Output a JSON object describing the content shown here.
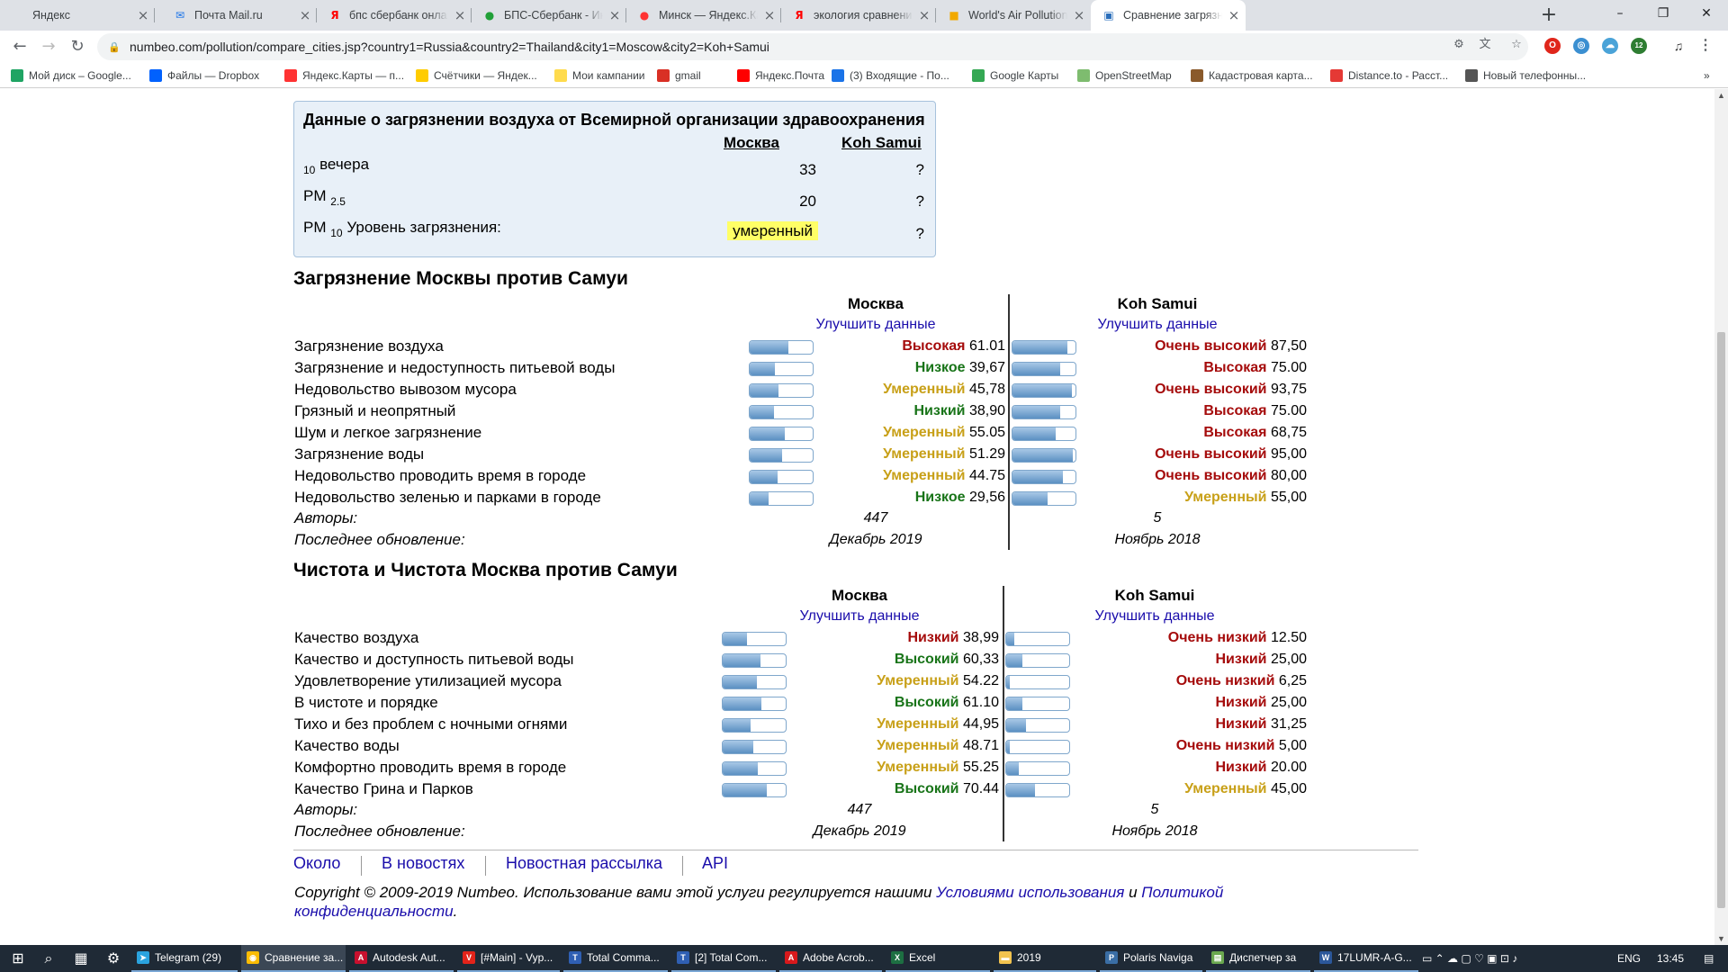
{
  "browser": {
    "tabs": [
      {
        "title": "Яндекс",
        "icon": "yandex-icon",
        "color": "#dee1e6"
      },
      {
        "title": "Почта Mail.ru",
        "icon": "mail-icon",
        "color": "#1a73e8"
      },
      {
        "title": "бпс сбербанк онлайн — Яндекс",
        "icon": "yandex-icon",
        "color": "#ff0000"
      },
      {
        "title": "БПС-Сбербанк - Интернет",
        "icon": "sber-icon",
        "color": "#21a038"
      },
      {
        "title": "Минск — Яндекс.Карты",
        "icon": "map-pin-icon",
        "color": "#ff3333"
      },
      {
        "title": "экология сравнение город",
        "icon": "yandex-icon",
        "color": "#ff0000"
      },
      {
        "title": "World's Air Pollution: Real-t",
        "icon": "aqicn-icon",
        "color": "#f2a900"
      },
      {
        "title": "Сравнение загрязнения м",
        "icon": "numbeo-icon",
        "color": "#2a6ebb"
      }
    ],
    "url": "numbeo.com/pollution/compare_cities.jsp?country1=Russia&country2=Thailand&city1=Moscow&city2=Koh+Samui",
    "bookmarks": [
      {
        "label": "Мой диск – Google...",
        "icon": "google-drive-icon",
        "color": "#1fa463"
      },
      {
        "label": "Файлы — Dropbox",
        "icon": "dropbox-icon",
        "color": "#0061fe"
      },
      {
        "label": "Яндекс.Карты — п...",
        "icon": "map-pin-icon",
        "color": "#ff3333"
      },
      {
        "label": "Счётчики — Яндек...",
        "icon": "metrika-icon",
        "color": "#ffcc00"
      },
      {
        "label": "Мои кампании",
        "icon": "direct-icon",
        "color": "#ffdb4d"
      },
      {
        "label": "gmail",
        "icon": "gmail-icon",
        "color": "#d93025"
      },
      {
        "label": "Яндекс.Почта",
        "icon": "yandex-mail-icon",
        "color": "#ff0000"
      },
      {
        "label": "(3) Входящие - По...",
        "icon": "mail-icon",
        "color": "#1a73e8"
      },
      {
        "label": "Google Карты",
        "icon": "google-maps-icon",
        "color": "#34a853"
      },
      {
        "label": "OpenStreetMap",
        "icon": "osm-icon",
        "color": "#7ebc6f"
      },
      {
        "label": "Кадастровая карта...",
        "icon": "cadastre-icon",
        "color": "#8a5a2b"
      },
      {
        "label": "Distance.to - Расст...",
        "icon": "distance-icon",
        "color": "#e53935"
      },
      {
        "label": "Новый телефонны...",
        "icon": "globe-icon",
        "color": "#555555"
      }
    ],
    "ext_badge": "12"
  },
  "who": {
    "heading": "Данные о загрязнении воздуха от Всемирной организации здравоохранения",
    "city1": "Москва",
    "city2": "Koh Samui",
    "r1_sub": "10",
    "r1_label": "вечера",
    "r1_v1": "33",
    "r1_v2": "?",
    "r2_label": "PM",
    "r2_sub": "2.5",
    "r2_v1": "20",
    "r2_v2": "?",
    "r3_label": "PM",
    "r3_sub": "10",
    "r3_rest": "Уровень загрязнения:",
    "r3_v1": "умеренный",
    "r3_v2": "?"
  },
  "pollution": {
    "title": "Загрязнение Москвы против Самуи",
    "city1": "Москва",
    "city2": "Koh Samui",
    "improve": "Улучшить данные",
    "rows": [
      {
        "label": "Загрязнение воздуха",
        "w1": "Высокая",
        "v1": "61.01",
        "c1": "red",
        "w2": "Очень высокий",
        "v2": "87,50",
        "c2": "red",
        "p1": 61.01,
        "p2": 87.5
      },
      {
        "label": "Загрязнение и недоступность питьевой воды",
        "w1": "Низкое",
        "v1": "39,67",
        "c1": "grn",
        "w2": "Высокая",
        "v2": "75.00",
        "c2": "red",
        "p1": 39.67,
        "p2": 75
      },
      {
        "label": "Недовольство вывозом мусора",
        "w1": "Умеренный",
        "v1": "45,78",
        "c1": "yel",
        "w2": "Очень высокий",
        "v2": "93,75",
        "c2": "red",
        "p1": 45.78,
        "p2": 93.75
      },
      {
        "label": "Грязный и неопрятный",
        "w1": "Низкий",
        "v1": "38,90",
        "c1": "grn",
        "w2": "Высокая",
        "v2": "75.00",
        "c2": "red",
        "p1": 38.9,
        "p2": 75
      },
      {
        "label": "Шум и легкое загрязнение",
        "w1": "Умеренный",
        "v1": "55.05",
        "c1": "yel",
        "w2": "Высокая",
        "v2": "68,75",
        "c2": "red",
        "p1": 55.05,
        "p2": 68.75
      },
      {
        "label": "Загрязнение воды",
        "w1": "Умеренный",
        "v1": "51.29",
        "c1": "yel",
        "w2": "Очень высокий",
        "v2": "95,00",
        "c2": "red",
        "p1": 51.29,
        "p2": 95
      },
      {
        "label": "Недовольство проводить время в городе",
        "w1": "Умеренный",
        "v1": "44.75",
        "c1": "yel",
        "w2": "Очень высокий",
        "v2": "80,00",
        "c2": "red",
        "p1": 44.75,
        "p2": 80
      },
      {
        "label": "Недовольство зеленью и парками в городе",
        "w1": "Низкое",
        "v1": "29,56",
        "c1": "grn",
        "w2": "Умеренный",
        "v2": "55,00",
        "c2": "yel",
        "p1": 29.56,
        "p2": 55
      }
    ],
    "authors_label": "Авторы:",
    "authors1": "447",
    "authors2": "5",
    "updated_label": "Последнее обновление:",
    "updated1": "Декабрь 2019",
    "updated2": "Ноябрь 2018"
  },
  "purity": {
    "title": "Чистота и Чистота Москва против Самуи",
    "city1": "Москва",
    "city2": "Koh Samui",
    "improve": "Улучшить данные",
    "rows": [
      {
        "label": "Качество воздуха",
        "w1": "Низкий",
        "v1": "38,99",
        "c1": "red",
        "w2": "Очень низкий",
        "v2": "12.50",
        "c2": "red",
        "p1": 38.99,
        "p2": 12.5
      },
      {
        "label": "Качество и доступность питьевой воды",
        "w1": "Высокий",
        "v1": "60,33",
        "c1": "grn",
        "w2": "Низкий",
        "v2": "25,00",
        "c2": "red",
        "p1": 60.33,
        "p2": 25
      },
      {
        "label": "Удовлетворение утилизацией мусора",
        "w1": "Умеренный",
        "v1": "54.22",
        "c1": "yel",
        "w2": "Очень низкий",
        "v2": "6,25",
        "c2": "red",
        "p1": 54.22,
        "p2": 6.25
      },
      {
        "label": "В чистоте и порядке",
        "w1": "Высокий",
        "v1": "61.10",
        "c1": "grn",
        "w2": "Низкий",
        "v2": "25,00",
        "c2": "red",
        "p1": 61.1,
        "p2": 25
      },
      {
        "label": "Тихо и без проблем с ночными огнями",
        "w1": "Умеренный",
        "v1": "44,95",
        "c1": "yel",
        "w2": "Низкий",
        "v2": "31,25",
        "c2": "red",
        "p1": 44.95,
        "p2": 31.25
      },
      {
        "label": "Качество воды",
        "w1": "Умеренный",
        "v1": "48.71",
        "c1": "yel",
        "w2": "Очень низкий",
        "v2": "5,00",
        "c2": "red",
        "p1": 48.71,
        "p2": 5
      },
      {
        "label": "Комфортно проводить время в городе",
        "w1": "Умеренный",
        "v1": "55.25",
        "c1": "yel",
        "w2": "Низкий",
        "v2": "20.00",
        "c2": "red",
        "p1": 55.25,
        "p2": 20
      },
      {
        "label": "Качество Грина и Парков",
        "w1": "Высокий",
        "v1": "70.44",
        "c1": "grn",
        "w2": "Умеренный",
        "v2": "45,00",
        "c2": "yel",
        "p1": 70.44,
        "p2": 45
      }
    ],
    "authors_label": "Авторы:",
    "authors1": "447",
    "authors2": "5",
    "updated_label": "Последнее обновление:",
    "updated1": "Декабрь 2019",
    "updated2": "Ноябрь 2018"
  },
  "footer": {
    "links": [
      "Около",
      "В новостях",
      "Новостная рассылка",
      "API"
    ],
    "copy_text": "Copyright © 2009-2019 Numbeo. Использование вами этой услуги регулируется нашими ",
    "terms": "Условиями использования",
    "and": " и ",
    "privacy": "Политикой конфиденциальности",
    "dot": "."
  },
  "taskbar": {
    "apps": [
      {
        "label": "Telegram (29)",
        "icon": "telegram-icon",
        "color": "#2aa3df"
      },
      {
        "label": "Сравнение за...",
        "icon": "chrome-icon",
        "color": "#fbbc04"
      },
      {
        "label": "Autodesk Aut...",
        "icon": "autocad-icon",
        "color": "#c8102e"
      },
      {
        "label": "[#Main] - Vyp...",
        "icon": "vyprvpn-icon",
        "color": "#e2231a"
      },
      {
        "label": "Total Comma...",
        "icon": "total-commander-icon",
        "color": "#2f5fb3"
      },
      {
        "label": "[2] Total Com...",
        "icon": "total-commander-icon",
        "color": "#2f5fb3"
      },
      {
        "label": "Adobe Acrob...",
        "icon": "acrobat-icon",
        "color": "#d7191c"
      },
      {
        "label": "Excel",
        "icon": "excel-icon",
        "color": "#1d6f42"
      },
      {
        "label": "2019",
        "icon": "folder-icon",
        "color": "#f2c34f"
      },
      {
        "label": "Polaris Naviga",
        "icon": "polaris-icon",
        "color": "#3a6ea5"
      },
      {
        "label": "Диспетчер за",
        "icon": "task-manager-icon",
        "color": "#6aa84f"
      },
      {
        "label": "17LUMR-A-G...",
        "icon": "word-icon",
        "color": "#2b579a"
      }
    ],
    "lang": "ENG",
    "time": "13:45"
  }
}
